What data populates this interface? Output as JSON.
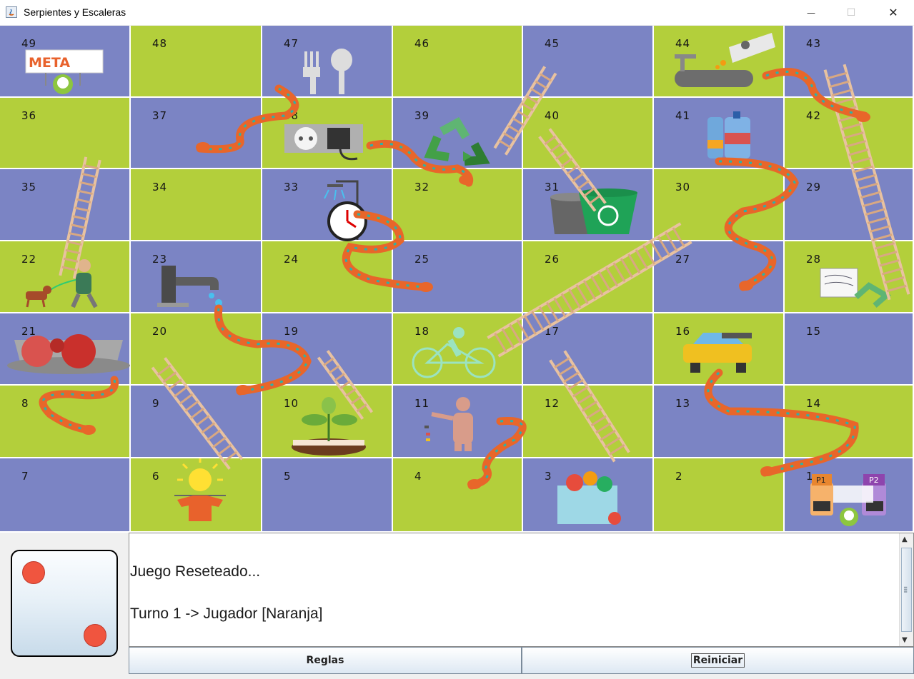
{
  "window": {
    "title": "Serpientes y Escaleras",
    "controls": {
      "minimize": "—",
      "maximize": "☐",
      "close": "✕"
    }
  },
  "board": {
    "colors": {
      "purple": "#7b84c4",
      "green": "#b3cf3b",
      "grid": "#ffffff"
    },
    "rows": [
      [
        "49",
        "48",
        "47",
        "46",
        "45",
        "44",
        "43"
      ],
      [
        "36",
        "37",
        "38",
        "39",
        "40",
        "41",
        "42"
      ],
      [
        "35",
        "34",
        "33",
        "32",
        "31",
        "30",
        "29"
      ],
      [
        "22",
        "23",
        "24",
        "25",
        "26",
        "27",
        "28"
      ],
      [
        "21",
        "20",
        "19",
        "18",
        "17",
        "16",
        "15"
      ],
      [
        "8",
        "9",
        "10",
        "11",
        "12",
        "13",
        "14"
      ],
      [
        "7",
        "6",
        "5",
        "4",
        "3",
        "2",
        "1"
      ]
    ],
    "goal_sign": "META",
    "players": [
      {
        "label": "P1",
        "color": "#e8862f"
      },
      {
        "label": "P2",
        "color": "#8e44ad"
      }
    ],
    "icons": [
      "meta-sign-icon",
      "fork-spoon-icon",
      "faucet-soap-icon",
      "power-outlet-icon",
      "recycle-icon",
      "water-bottles-icon",
      "shower-timer-icon",
      "recycle-bin-icon",
      "dog-walker-icon",
      "water-tap-icon",
      "papers-recycle-icon",
      "apples-basket-icon",
      "bicycle-icon",
      "car-wash-icon",
      "plant-icon",
      "person-trash-icon",
      "sun-clothes-icon",
      "shopping-bag-icon",
      "snake-icon",
      "ladder-icon"
    ]
  },
  "die": {
    "value": 2
  },
  "log": {
    "lines": [
      "Juego Reseteado...",
      "Turno 1 -> Jugador [Naranja]"
    ]
  },
  "buttons": {
    "rules": "Reglas",
    "reset": "Reiniciar"
  }
}
